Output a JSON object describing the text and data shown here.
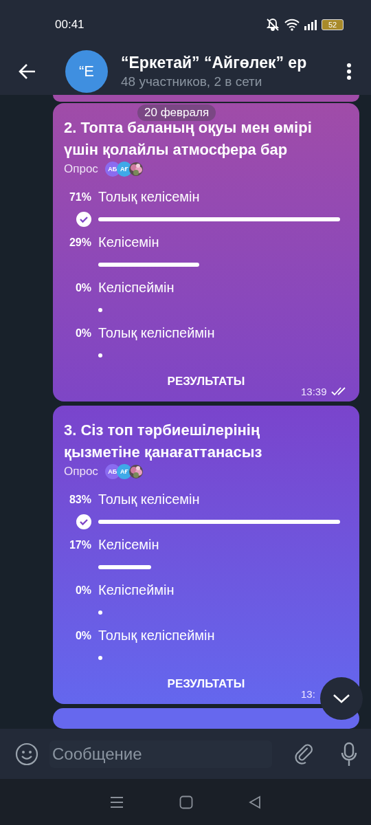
{
  "status_bar": {
    "time": "00:41",
    "battery": "52"
  },
  "header": {
    "avatar": "“E",
    "title": "“Еркетай” “Айгөлек” ер",
    "subtitle": "48 участников, 2 в сети"
  },
  "date_pill": "20 февраля",
  "polls": [
    {
      "question": "2. Топта баланың оқуы мен өмірі үшін қолайлы атмосфера бар",
      "kind_label": "Опрос",
      "voters": [
        {
          "initials": "АБ",
          "color": "#8a6cf0"
        },
        {
          "initials": "АҒ",
          "color": "#3fa9e8"
        },
        {
          "kind": "picture"
        }
      ],
      "options": [
        {
          "percent": "71%",
          "label": "Толық келісемін",
          "chosen": true
        },
        {
          "percent": "29%",
          "label": "Келісемін",
          "chosen": false
        },
        {
          "percent": "0%",
          "label": "Келіспеймін",
          "chosen": false
        },
        {
          "percent": "0%",
          "label": "Толық келіспеймін",
          "chosen": false
        }
      ],
      "results_button": "РЕЗУЛЬТАТЫ",
      "time": "13:39",
      "read": true
    },
    {
      "question": "3. Сіз топ тәрбиешілерінің қызметіне қанағаттанасыз",
      "kind_label": "Опрос",
      "voters": [
        {
          "initials": "АБ",
          "color": "#8a6cf0"
        },
        {
          "initials": "АҒ",
          "color": "#3fa9e8"
        },
        {
          "kind": "picture"
        }
      ],
      "options": [
        {
          "percent": "83%",
          "label": "Толық келісемін",
          "chosen": true
        },
        {
          "percent": "17%",
          "label": "Келісемін",
          "chosen": false
        },
        {
          "percent": "0%",
          "label": "Келіспеймін",
          "chosen": false
        },
        {
          "percent": "0%",
          "label": "Толық келіспеймін",
          "chosen": false
        }
      ],
      "results_button": "РЕЗУЛЬТАТЫ",
      "time": "13:",
      "read": false
    }
  ],
  "composer": {
    "placeholder": "Сообщение"
  }
}
